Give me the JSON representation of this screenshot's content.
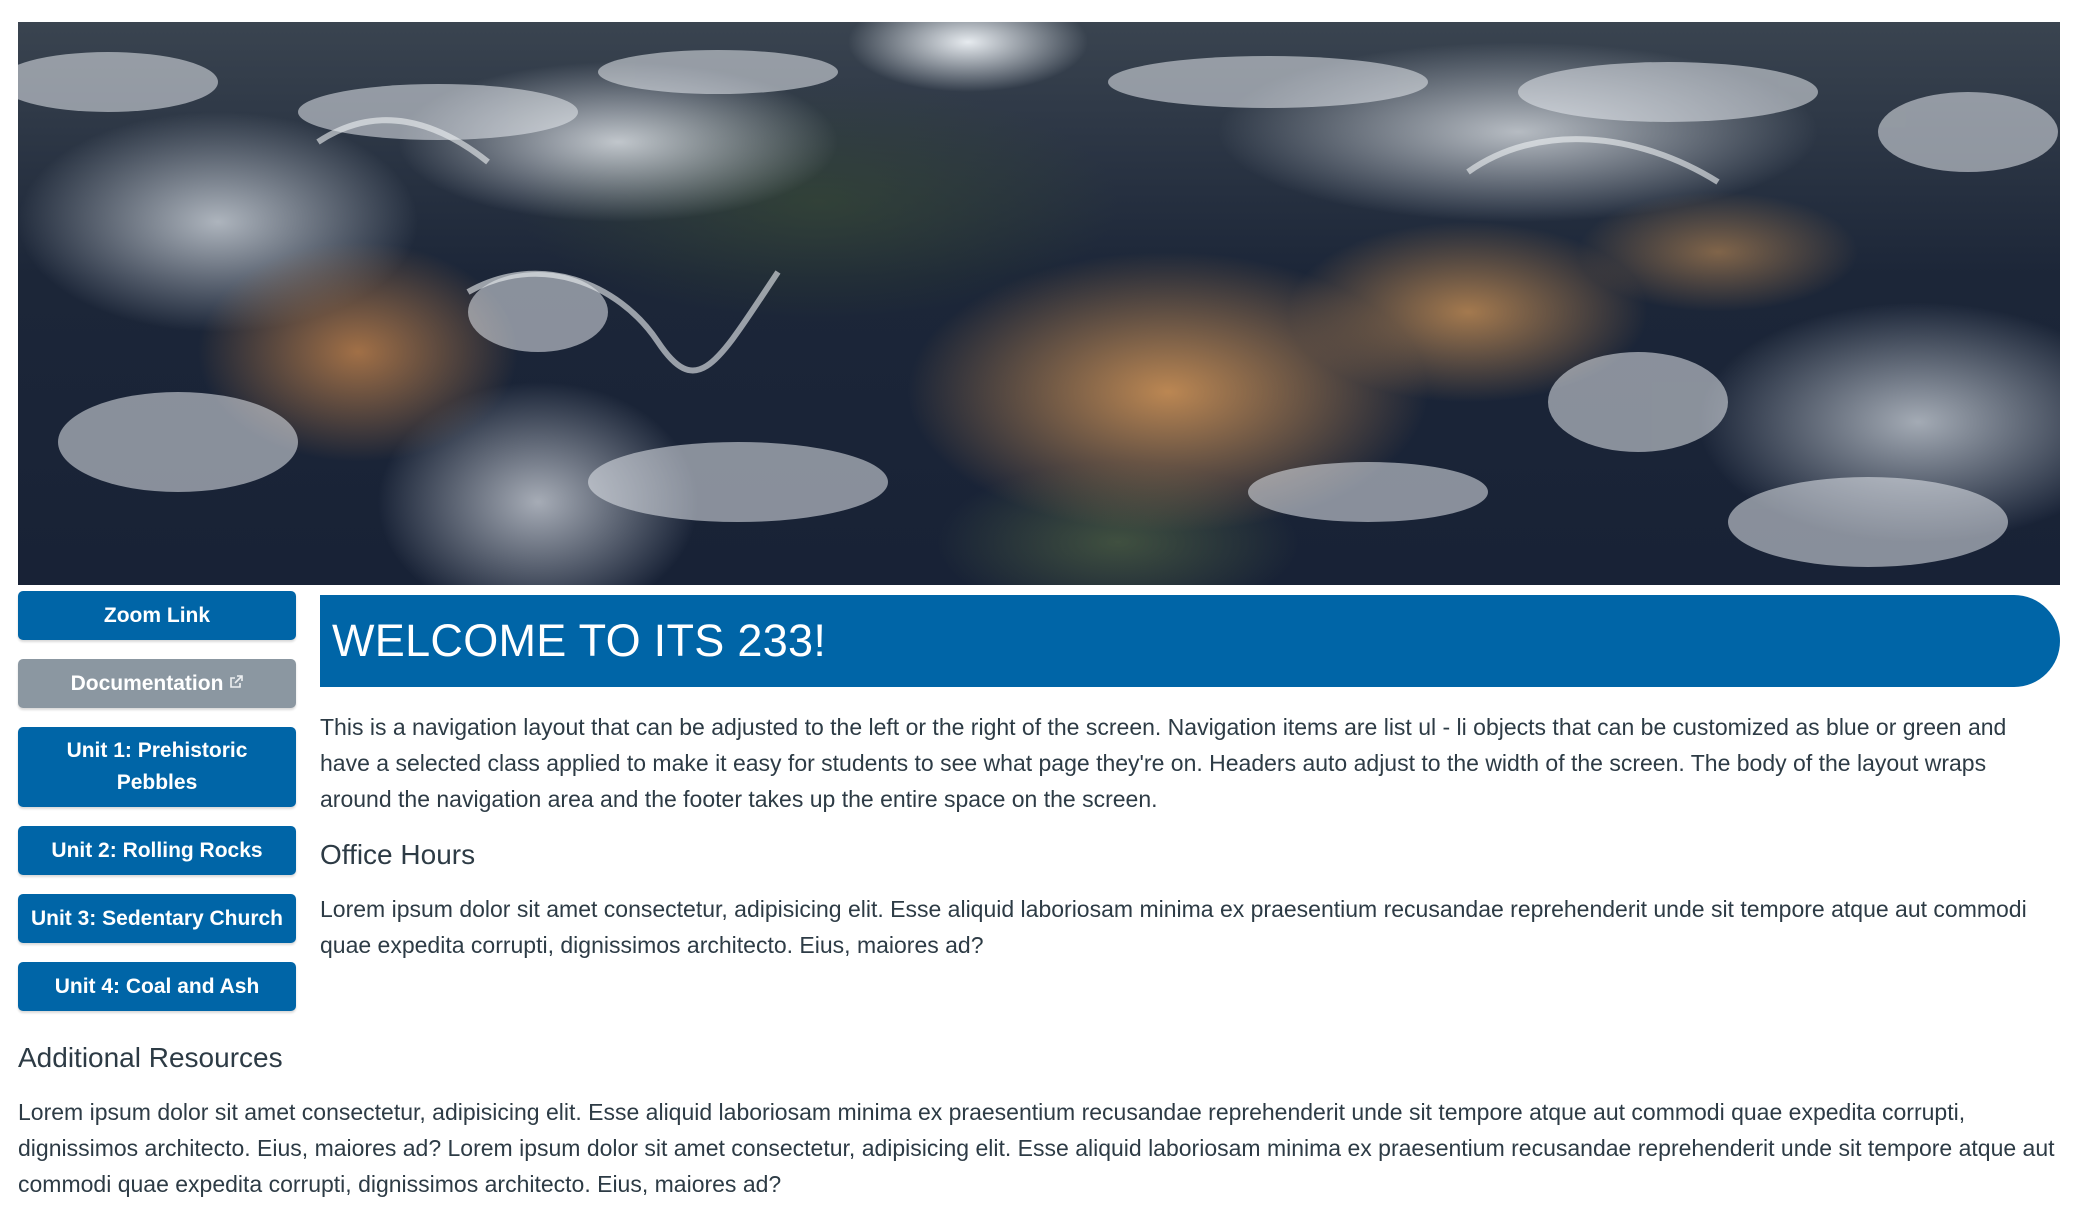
{
  "banner": {
    "alt": "Satellite image of Earth"
  },
  "nav": {
    "items": [
      {
        "label": "Zoom Link",
        "style": "blue",
        "external": false
      },
      {
        "label": "Documentation",
        "style": "grey",
        "external": true
      },
      {
        "label": "Unit 1: Prehistoric Pebbles",
        "style": "blue",
        "external": false
      },
      {
        "label": "Unit 2: Rolling Rocks",
        "style": "blue",
        "external": false
      },
      {
        "label": "Unit 3: Sedentary Church",
        "style": "blue",
        "external": false
      },
      {
        "label": "Unit 4: Coal and Ash",
        "style": "blue",
        "external": false
      }
    ]
  },
  "main": {
    "title": "WELCOME TO ITS 233!",
    "intro": "This is a navigation layout that can be adjusted to the left or the right of the screen. Navigation items are list ul - li objects that can be customized as blue or green and have a selected class applied to make it easy for students to see what page they're on. Headers auto adjust to the width of the screen. The body of the layout wraps around the navigation area and the footer takes up the entire space on the screen.",
    "office_hours_title": "Office Hours",
    "office_hours_text": "Lorem ipsum dolor sit amet consectetur, adipisicing elit. Esse aliquid laboriosam minima ex praesentium recusandae reprehenderit unde sit tempore atque aut commodi quae expedita corrupti, dignissimos architecto. Eius, maiores ad?"
  },
  "resources": {
    "title": "Additional Resources",
    "text": "Lorem ipsum dolor sit amet consectetur, adipisicing elit. Esse aliquid laboriosam minima ex praesentium recusandae reprehenderit unde sit tempore atque aut commodi quae expedita corrupti, dignissimos architecto. Eius, maiores ad? Lorem ipsum dolor sit amet consectetur, adipisicing elit. Esse aliquid laboriosam minima ex praesentium recusandae reprehenderit unde sit tempore atque aut commodi quae expedita corrupti, dignissimos architecto. Eius, maiores ad?"
  },
  "colors": {
    "primary": "#0065a7",
    "secondary": "#8b97a1",
    "text": "#2d3b45"
  }
}
